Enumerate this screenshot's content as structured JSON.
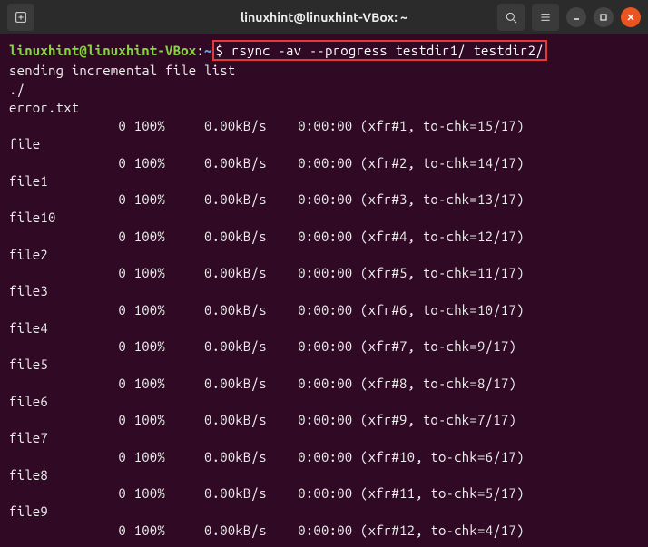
{
  "titlebar": {
    "title": "linuxhint@linuxhint-VBox: ~"
  },
  "prompt": {
    "userhost": "linuxhint@linuxhint-VBox",
    "colon": ":",
    "path": "~",
    "symbol": "$",
    "command": "rsync -av --progress testdir1/ testdir2/"
  },
  "output": {
    "header": "sending incremental file list",
    "dot": "./",
    "files": [
      {
        "name": "error.txt",
        "size": "0",
        "pct": "100%",
        "rate": "0.00kB/s",
        "time": "0:00:00",
        "xfr": "(xfr#1, to-chk=15/17)"
      },
      {
        "name": "file",
        "size": "0",
        "pct": "100%",
        "rate": "0.00kB/s",
        "time": "0:00:00",
        "xfr": "(xfr#2, to-chk=14/17)"
      },
      {
        "name": "file1",
        "size": "0",
        "pct": "100%",
        "rate": "0.00kB/s",
        "time": "0:00:00",
        "xfr": "(xfr#3, to-chk=13/17)"
      },
      {
        "name": "file10",
        "size": "0",
        "pct": "100%",
        "rate": "0.00kB/s",
        "time": "0:00:00",
        "xfr": "(xfr#4, to-chk=12/17)"
      },
      {
        "name": "file2",
        "size": "0",
        "pct": "100%",
        "rate": "0.00kB/s",
        "time": "0:00:00",
        "xfr": "(xfr#5, to-chk=11/17)"
      },
      {
        "name": "file3",
        "size": "0",
        "pct": "100%",
        "rate": "0.00kB/s",
        "time": "0:00:00",
        "xfr": "(xfr#6, to-chk=10/17)"
      },
      {
        "name": "file4",
        "size": "0",
        "pct": "100%",
        "rate": "0.00kB/s",
        "time": "0:00:00",
        "xfr": "(xfr#7, to-chk=9/17)"
      },
      {
        "name": "file5",
        "size": "0",
        "pct": "100%",
        "rate": "0.00kB/s",
        "time": "0:00:00",
        "xfr": "(xfr#8, to-chk=8/17)"
      },
      {
        "name": "file6",
        "size": "0",
        "pct": "100%",
        "rate": "0.00kB/s",
        "time": "0:00:00",
        "xfr": "(xfr#9, to-chk=7/17)"
      },
      {
        "name": "file7",
        "size": "0",
        "pct": "100%",
        "rate": "0.00kB/s",
        "time": "0:00:00",
        "xfr": "(xfr#10, to-chk=6/17)"
      },
      {
        "name": "file8",
        "size": "0",
        "pct": "100%",
        "rate": "0.00kB/s",
        "time": "0:00:00",
        "xfr": "(xfr#11, to-chk=5/17)"
      },
      {
        "name": "file9",
        "size": "0",
        "pct": "100%",
        "rate": "0.00kB/s",
        "time": "0:00:00",
        "xfr": "(xfr#12, to-chk=4/17)"
      }
    ]
  }
}
